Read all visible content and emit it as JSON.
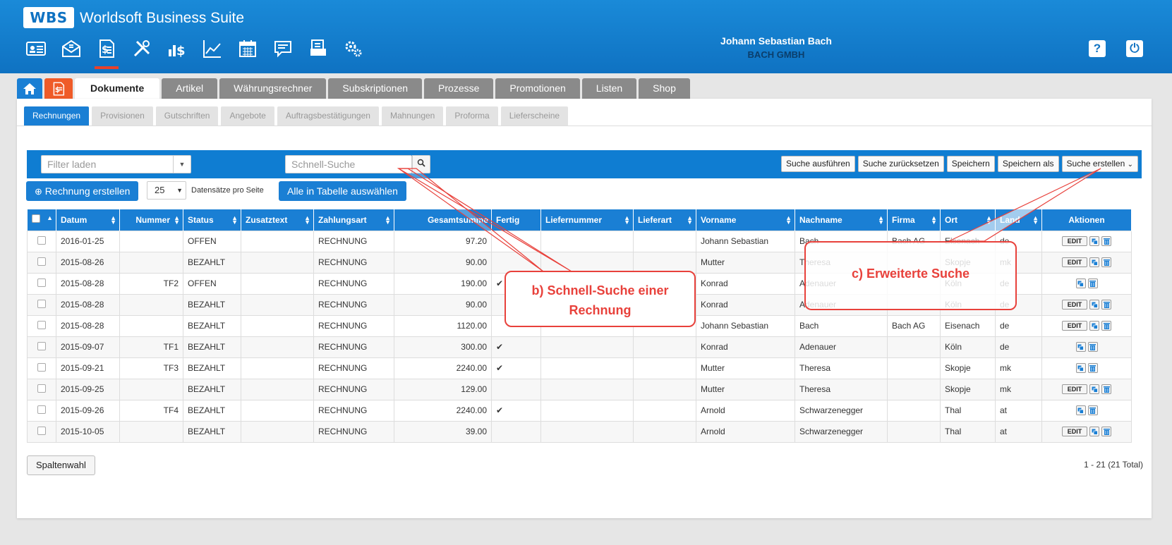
{
  "app": {
    "logo_text": "WBS",
    "title": "Worldsoft Business Suite"
  },
  "user": {
    "name": "Johann Sebastian Bach",
    "company": "BACH GMBH"
  },
  "header_buttons": {
    "help": "?",
    "power": "⏻"
  },
  "main_tabs": [
    "Dokumente",
    "Artikel",
    "Währungsrechner",
    "Subskriptionen",
    "Prozesse",
    "Promotionen",
    "Listen",
    "Shop"
  ],
  "sub_tabs": [
    "Rechnungen",
    "Provisionen",
    "Gutschriften",
    "Angebote",
    "Auftragsbestätigungen",
    "Mahnungen",
    "Proforma",
    "Lieferscheine"
  ],
  "filter": {
    "load_placeholder": "Filter laden",
    "quick_search_placeholder": "Schnell-Suche",
    "buttons": [
      "Suche ausführen",
      "Suche zurücksetzen",
      "Speichern",
      "Speichern als",
      "Suche erstellen"
    ]
  },
  "actions": {
    "create_label": "Rechnung erstellen",
    "per_page_value": "25",
    "per_page_label": "Datensätze pro Seite",
    "select_all_label": "Alle in Tabelle auswählen"
  },
  "table": {
    "columns": [
      "Datum",
      "Nummer",
      "Status",
      "Zusatztext",
      "Zahlungsart",
      "Gesamtsumme",
      "Fertig",
      "Liefernummer",
      "Lieferart",
      "Vorname",
      "Nachname",
      "Firma",
      "Ort",
      "Land",
      "Aktionen"
    ],
    "rows": [
      {
        "datum": "2016-01-25",
        "nummer": "",
        "status": "OFFEN",
        "zahlungsart": "RECHNUNG",
        "summe": "97.20",
        "fertig": "",
        "vorname": "Johann Sebastian",
        "nachname": "Bach",
        "firma": "Bach AG",
        "ort": "Eisenach",
        "land": "de",
        "edit": true
      },
      {
        "datum": "2015-08-26",
        "nummer": "",
        "status": "BEZAHLT",
        "zahlungsart": "RECHNUNG",
        "summe": "90.00",
        "fertig": "",
        "vorname": "Mutter",
        "nachname": "Theresa",
        "firma": "",
        "ort": "Skopje",
        "land": "mk",
        "edit": true
      },
      {
        "datum": "2015-08-28",
        "nummer": "TF2",
        "status": "OFFEN",
        "zahlungsart": "RECHNUNG",
        "summe": "190.00",
        "fertig": "✔",
        "vorname": "Konrad",
        "nachname": "Adenauer",
        "firma": "",
        "ort": "Köln",
        "land": "de",
        "edit": false
      },
      {
        "datum": "2015-08-28",
        "nummer": "",
        "status": "BEZAHLT",
        "zahlungsart": "RECHNUNG",
        "summe": "90.00",
        "fertig": "",
        "vorname": "Konrad",
        "nachname": "Adenauer",
        "firma": "",
        "ort": "Köln",
        "land": "de",
        "edit": true
      },
      {
        "datum": "2015-08-28",
        "nummer": "",
        "status": "BEZAHLT",
        "zahlungsart": "RECHNUNG",
        "summe": "1120.00",
        "fertig": "",
        "vorname": "Johann Sebastian",
        "nachname": "Bach",
        "firma": "Bach AG",
        "ort": "Eisenach",
        "land": "de",
        "edit": true
      },
      {
        "datum": "2015-09-07",
        "nummer": "TF1",
        "status": "BEZAHLT",
        "zahlungsart": "RECHNUNG",
        "summe": "300.00",
        "fertig": "✔",
        "vorname": "Konrad",
        "nachname": "Adenauer",
        "firma": "",
        "ort": "Köln",
        "land": "de",
        "edit": false
      },
      {
        "datum": "2015-09-21",
        "nummer": "TF3",
        "status": "BEZAHLT",
        "zahlungsart": "RECHNUNG",
        "summe": "2240.00",
        "fertig": "✔",
        "vorname": "Mutter",
        "nachname": "Theresa",
        "firma": "",
        "ort": "Skopje",
        "land": "mk",
        "edit": false
      },
      {
        "datum": "2015-09-25",
        "nummer": "",
        "status": "BEZAHLT",
        "zahlungsart": "RECHNUNG",
        "summe": "129.00",
        "fertig": "",
        "vorname": "Mutter",
        "nachname": "Theresa",
        "firma": "",
        "ort": "Skopje",
        "land": "mk",
        "edit": true
      },
      {
        "datum": "2015-09-26",
        "nummer": "TF4",
        "status": "BEZAHLT",
        "zahlungsart": "RECHNUNG",
        "summe": "2240.00",
        "fertig": "✔",
        "vorname": "Arnold",
        "nachname": "Schwarzenegger",
        "firma": "",
        "ort": "Thal",
        "land": "at",
        "edit": false
      },
      {
        "datum": "2015-10-05",
        "nummer": "",
        "status": "BEZAHLT",
        "zahlungsart": "RECHNUNG",
        "summe": "39.00",
        "fertig": "",
        "vorname": "Arnold",
        "nachname": "Schwarzenegger",
        "firma": "",
        "ort": "Thal",
        "land": "at",
        "edit": true
      }
    ],
    "edit_label": "EDIT"
  },
  "footer": {
    "columns_button": "Spaltenwahl",
    "pager_info": "1 - 21 (21 Total)"
  },
  "annotations": {
    "quick_search": "b) Schnell-Suche einer Rechnung",
    "advanced_search": "c) Erweiterte Suche",
    "color": "#e8413b"
  },
  "colors": {
    "header_blue": "#0f72c2",
    "accent_blue": "#1a7fd4",
    "doc_orange": "#ef5b28"
  }
}
